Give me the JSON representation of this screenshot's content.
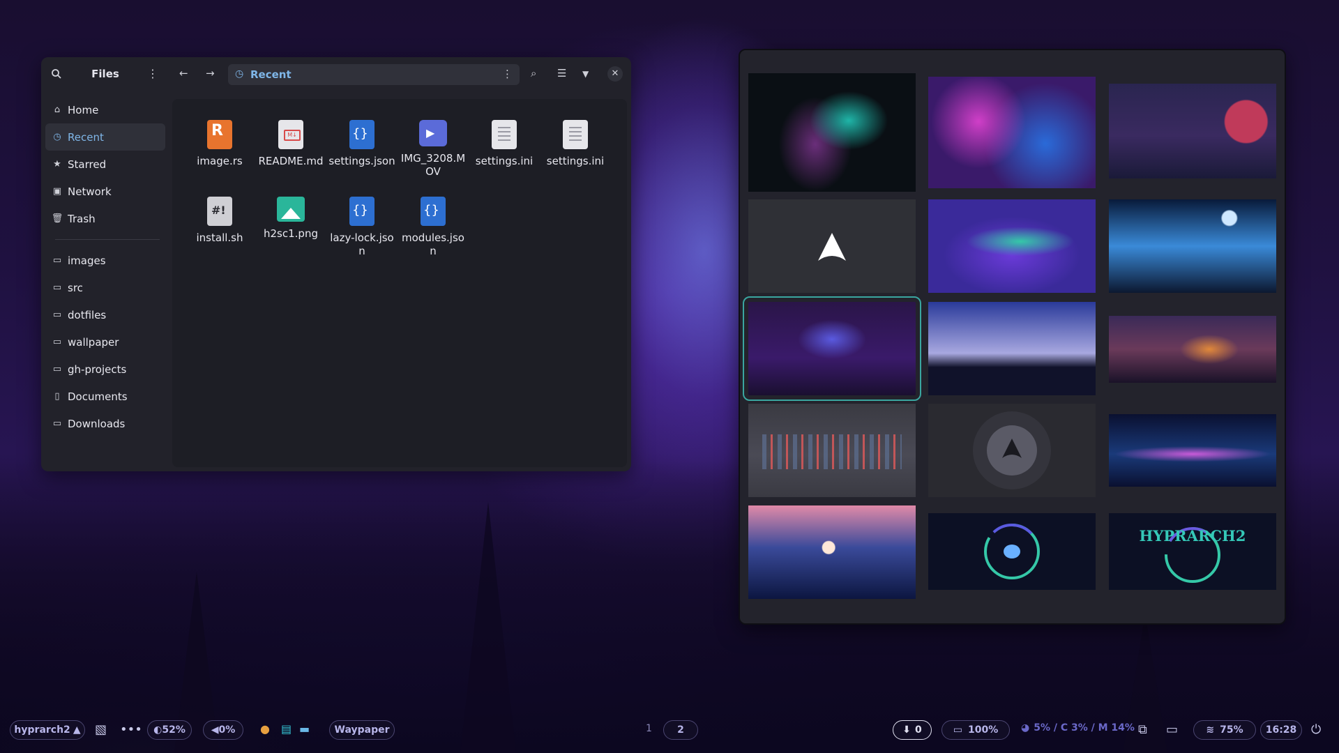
{
  "files": {
    "title": "Files",
    "location": "Recent",
    "nav": [
      {
        "label": "Home",
        "icon": "home-icon"
      },
      {
        "label": "Recent",
        "icon": "clock-icon",
        "active": true
      },
      {
        "label": "Starred",
        "icon": "star-icon"
      },
      {
        "label": "Network",
        "icon": "network-icon"
      },
      {
        "label": "Trash",
        "icon": "trash-icon"
      }
    ],
    "bookmarks": [
      "images",
      "src",
      "dotfiles",
      "wallpaper",
      "gh-projects",
      "Documents",
      "Downloads"
    ],
    "items": [
      {
        "name": "image.rs",
        "type": "rust",
        "color": "#e8742e"
      },
      {
        "name": "README.md",
        "type": "markdown",
        "color": "#e6e6ea"
      },
      {
        "name": "settings.json",
        "type": "json",
        "color": "#2d6fd1"
      },
      {
        "name": "IMG_3208.MOV",
        "type": "video",
        "color": "#5b6bd9"
      },
      {
        "name": "settings.ini",
        "type": "text",
        "color": "#e6e6ea"
      },
      {
        "name": "settings.ini",
        "type": "text",
        "color": "#e6e6ea"
      },
      {
        "name": "install.sh",
        "type": "script",
        "color": "#cfcfd4"
      },
      {
        "name": "h2sc1.png",
        "type": "image",
        "color": "#2ab69a"
      },
      {
        "name": "lazy-lock.json",
        "type": "json",
        "color": "#2d6fd1"
      },
      {
        "name": "modules.json",
        "type": "json",
        "color": "#2d6fd1"
      }
    ]
  },
  "wallpapers": {
    "items": [
      {
        "name": "teal-abstract",
        "colors": [
          "#0a0f14",
          "#1fb5a8",
          "#6a2e7a"
        ]
      },
      {
        "name": "fluid-purple-blue",
        "colors": [
          "#3a1a6a",
          "#2a6ad8",
          "#d03fc8"
        ]
      },
      {
        "name": "synthwave-sunset",
        "colors": [
          "#2a2550",
          "#c03a5a",
          "#1a1a38"
        ]
      },
      {
        "name": "arch-logo-gray",
        "colors": [
          "#2f3036",
          "#ffffff",
          "#2f3036"
        ]
      },
      {
        "name": "aurora",
        "colors": [
          "#3a2a9a",
          "#35c8a8",
          "#6a3ad8"
        ]
      },
      {
        "name": "mountain-lake-moon",
        "colors": [
          "#081a3a",
          "#3a8ad8",
          "#0c1830"
        ]
      },
      {
        "name": "purple-nebula-forest",
        "colors": [
          "#2a1548",
          "#5a5ae0",
          "#1a0f30"
        ],
        "selected": true
      },
      {
        "name": "forest-mountains-dusk",
        "colors": [
          "#2a3a9a",
          "#a8a8e0",
          "#10122a"
        ]
      },
      {
        "name": "orange-sunset-forest",
        "colors": [
          "#3a2a58",
          "#e0883a",
          "#1a1228"
        ]
      },
      {
        "name": "city-skyline",
        "colors": [
          "#3a3a42",
          "#e05a5a",
          "#5a6a8a"
        ]
      },
      {
        "name": "arch-logo-circle",
        "colors": [
          "#2a2a30",
          "#5a5a66",
          "#2a2a30"
        ]
      },
      {
        "name": "horizon-glow",
        "colors": [
          "#0a1030",
          "#c85ad8",
          "#1a3a7a"
        ]
      },
      {
        "name": "pink-moon-valley",
        "colors": [
          "#e08aa8",
          "#3a4a9a",
          "#0c1640"
        ]
      },
      {
        "name": "ghost-ring",
        "colors": [
          "#0c1024",
          "#35c8a8",
          "#5a5ae0"
        ]
      },
      {
        "name": "hyprarch2-logo",
        "colors": [
          "#0c1024",
          "#35c8a8",
          "#6a5ae0"
        ],
        "label": "HYPRARCH2"
      }
    ]
  },
  "bar": {
    "distro": "hyprarch2",
    "brightness": "52%",
    "volume": "0%",
    "active_app": "Waypaper",
    "workspaces": [
      "1",
      "2"
    ],
    "notifications": "0",
    "battery": "100%",
    "cpu_mem": "5% / C 3% / M 14%",
    "wifi": "75%",
    "clock": "16:28"
  }
}
